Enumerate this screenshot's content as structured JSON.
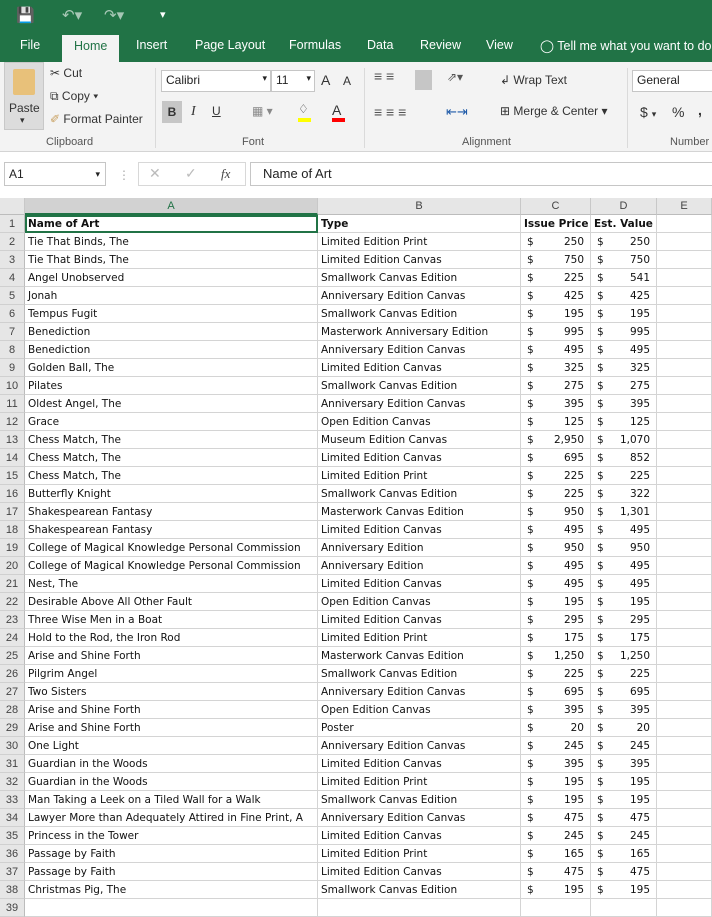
{
  "titlebar": {
    "icons": [
      "save-icon",
      "undo-icon",
      "redo-icon",
      "customize-icon"
    ]
  },
  "tabs": [
    "File",
    "Home",
    "Insert",
    "Page Layout",
    "Formulas",
    "Data",
    "Review",
    "View"
  ],
  "tell_me": "Tell me what you want to do",
  "ribbon": {
    "clipboard": {
      "paste": "Paste",
      "cut": "Cut",
      "copy": "Copy",
      "format_painter": "Format Painter",
      "label": "Clipboard"
    },
    "font": {
      "name": "Calibri",
      "size": "11",
      "bold": "B",
      "italic": "I",
      "underline": "U",
      "grow": "A",
      "shrink": "A",
      "font_color": "A",
      "label": "Font",
      "fill_color": "#ffff00",
      "text_color": "#ff0000"
    },
    "alignment": {
      "wrap": "Wrap Text",
      "merge": "Merge & Center",
      "label": "Alignment"
    },
    "number": {
      "format": "General",
      "currency": "$",
      "percent": "%",
      "comma": ",",
      "label": "Number"
    }
  },
  "formula_bar": {
    "name_box": "A1",
    "fx": "fx",
    "value": "Name of Art"
  },
  "columns": [
    "A",
    "B",
    "C",
    "D",
    "E"
  ],
  "header": {
    "name": "Name of Art",
    "type": "Type",
    "issue": "Issue Price",
    "est": "Est. Value"
  },
  "rows": [
    [
      "Tie That Binds, The",
      "Limited Edition Print",
      "250",
      "250"
    ],
    [
      "Tie That Binds, The",
      "Limited Edition Canvas",
      "750",
      "750"
    ],
    [
      "Angel Unobserved",
      "Smallwork Canvas Edition",
      "225",
      "541"
    ],
    [
      "Jonah",
      "Anniversary Edition Canvas",
      "425",
      "425"
    ],
    [
      "Tempus Fugit",
      "Smallwork Canvas Edition",
      "195",
      "195"
    ],
    [
      "Benediction",
      "Masterwork Anniversary Edition",
      "995",
      "995"
    ],
    [
      "Benediction",
      "Anniversary Edition Canvas",
      "495",
      "495"
    ],
    [
      "Golden Ball, The",
      "Limited Edition Canvas",
      "325",
      "325"
    ],
    [
      "Pilates",
      "Smallwork Canvas Edition",
      "275",
      "275"
    ],
    [
      "Oldest Angel, The",
      "Anniversary Edition Canvas",
      "395",
      "395"
    ],
    [
      "Grace",
      "Open Edition Canvas",
      "125",
      "125"
    ],
    [
      "Chess Match, The",
      "Museum Edition Canvas",
      "2,950",
      "1,070"
    ],
    [
      "Chess Match, The",
      "Limited Edition Canvas",
      "695",
      "852"
    ],
    [
      "Chess Match, The",
      "Limited Edition Print",
      "225",
      "225"
    ],
    [
      "Butterfly Knight",
      "Smallwork Canvas Edition",
      "225",
      "322"
    ],
    [
      "Shakespearean Fantasy",
      "Masterwork Canvas Edition",
      "950",
      "1,301"
    ],
    [
      "Shakespearean Fantasy",
      "Limited Edition Canvas",
      "495",
      "495"
    ],
    [
      "College of Magical Knowledge Personal Commission",
      "Anniversary Edition",
      "950",
      "950"
    ],
    [
      "College of Magical Knowledge Personal Commission",
      "Anniversary Edition",
      "495",
      "495"
    ],
    [
      "Nest, The",
      "Limited Edition Canvas",
      "495",
      "495"
    ],
    [
      "Desirable Above All Other Fault",
      "Open Edition Canvas",
      "195",
      "195"
    ],
    [
      "Three Wise Men in a Boat",
      "Limited Edition Canvas",
      "295",
      "295"
    ],
    [
      "Hold to the Rod, the Iron Rod",
      "Limited Edition Print",
      "175",
      "175"
    ],
    [
      "Arise and Shine Forth",
      "Masterwork Canvas Edition",
      "1,250",
      "1,250"
    ],
    [
      "Pilgrim Angel",
      "Smallwork Canvas Edition",
      "225",
      "225"
    ],
    [
      "Two Sisters",
      "Anniversary Edition Canvas",
      "695",
      "695"
    ],
    [
      "Arise and Shine Forth",
      "Open Edition Canvas",
      "395",
      "395"
    ],
    [
      "Arise and Shine Forth",
      "Poster",
      "20",
      "20"
    ],
    [
      "One Light",
      "Anniversary Edition Canvas",
      "245",
      "245"
    ],
    [
      "Guardian in the Woods",
      "Limited Edition Canvas",
      "395",
      "395"
    ],
    [
      "Guardian in the Woods",
      "Limited Edition Print",
      "195",
      "195"
    ],
    [
      "Man Taking a Leek on a Tiled Wall for a Walk",
      "Smallwork Canvas Edition",
      "195",
      "195"
    ],
    [
      "Lawyer More than Adequately Attired in Fine Print, A",
      "Anniversary Edition Canvas",
      "475",
      "475"
    ],
    [
      "Princess in the Tower",
      "Limited Edition Canvas",
      "245",
      "245"
    ],
    [
      "Passage by Faith",
      "Limited Edition Print",
      "165",
      "165"
    ],
    [
      "Passage by Faith",
      "Limited Edition Canvas",
      "475",
      "475"
    ],
    [
      "Christmas Pig, The",
      "Smallwork Canvas Edition",
      "195",
      "195"
    ]
  ],
  "currency_symbol": "$",
  "row_numbers": [
    "1",
    "2",
    "3",
    "4",
    "5",
    "6",
    "7",
    "8",
    "9",
    "10",
    "11",
    "12",
    "13",
    "14",
    "15",
    "16",
    "17",
    "18",
    "19",
    "20",
    "21",
    "22",
    "23",
    "24",
    "25",
    "26",
    "27",
    "28",
    "29",
    "30",
    "31",
    "32",
    "33",
    "34",
    "35",
    "36",
    "37",
    "38",
    "39"
  ]
}
